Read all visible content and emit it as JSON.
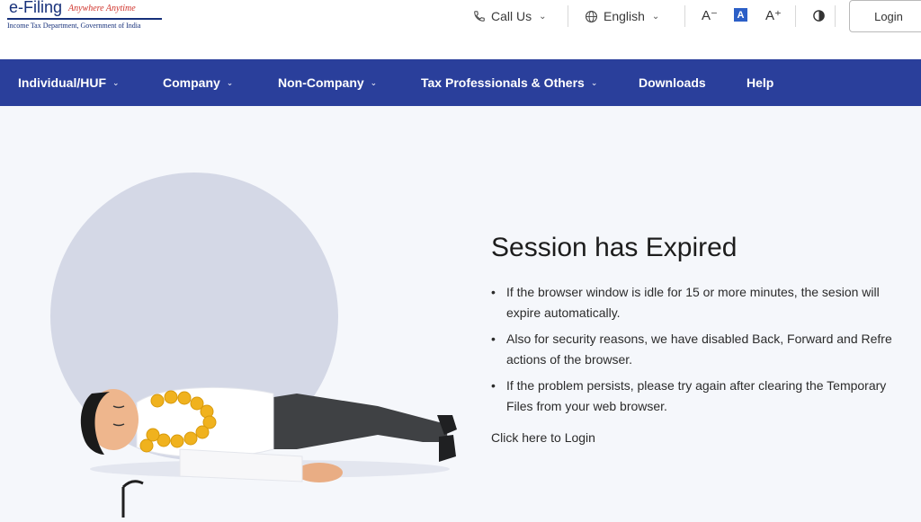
{
  "header": {
    "logo_main": "e-Filing",
    "logo_tagline": "Anywhere Anytime",
    "logo_subtitle": "Income Tax Department, Government of India",
    "call_us_label": "Call Us",
    "language_label": "English",
    "font_decrease_label": "A⁻",
    "font_default_label": "A",
    "font_increase_label": "A⁺",
    "login_label": "Login"
  },
  "nav": {
    "items": [
      {
        "label": "Individual/HUF",
        "has_dropdown": true
      },
      {
        "label": "Company",
        "has_dropdown": true
      },
      {
        "label": "Non-Company",
        "has_dropdown": true
      },
      {
        "label": "Tax Professionals & Others",
        "has_dropdown": true
      },
      {
        "label": "Downloads",
        "has_dropdown": false
      },
      {
        "label": "Help",
        "has_dropdown": false
      }
    ]
  },
  "message": {
    "title": "Session has Expired",
    "points": [
      {
        "line1": "If the browser window is idle for 15 or more minutes, the sesion will",
        "line2": "expire automatically."
      },
      {
        "line1": "Also for security reasons, we have disabled Back, Forward and Refre",
        "line2": "actions of the browser."
      },
      {
        "line1": "If the problem persists, please try again after clearing the Temporary",
        "line2": "Files from your web browser."
      }
    ],
    "bullet": "•",
    "login_link": "Click here to Login"
  },
  "icons": {
    "phone": "phone-icon",
    "globe": "globe-icon",
    "contrast": "contrast-icon",
    "chevron": "chevron-down-icon"
  },
  "colors": {
    "nav_background": "#2a3f9b",
    "page_background": "#f5f7fb",
    "logo_blue": "#16307a",
    "logo_red": "#d0342c",
    "illustration_circle": "#d4d8e6"
  }
}
